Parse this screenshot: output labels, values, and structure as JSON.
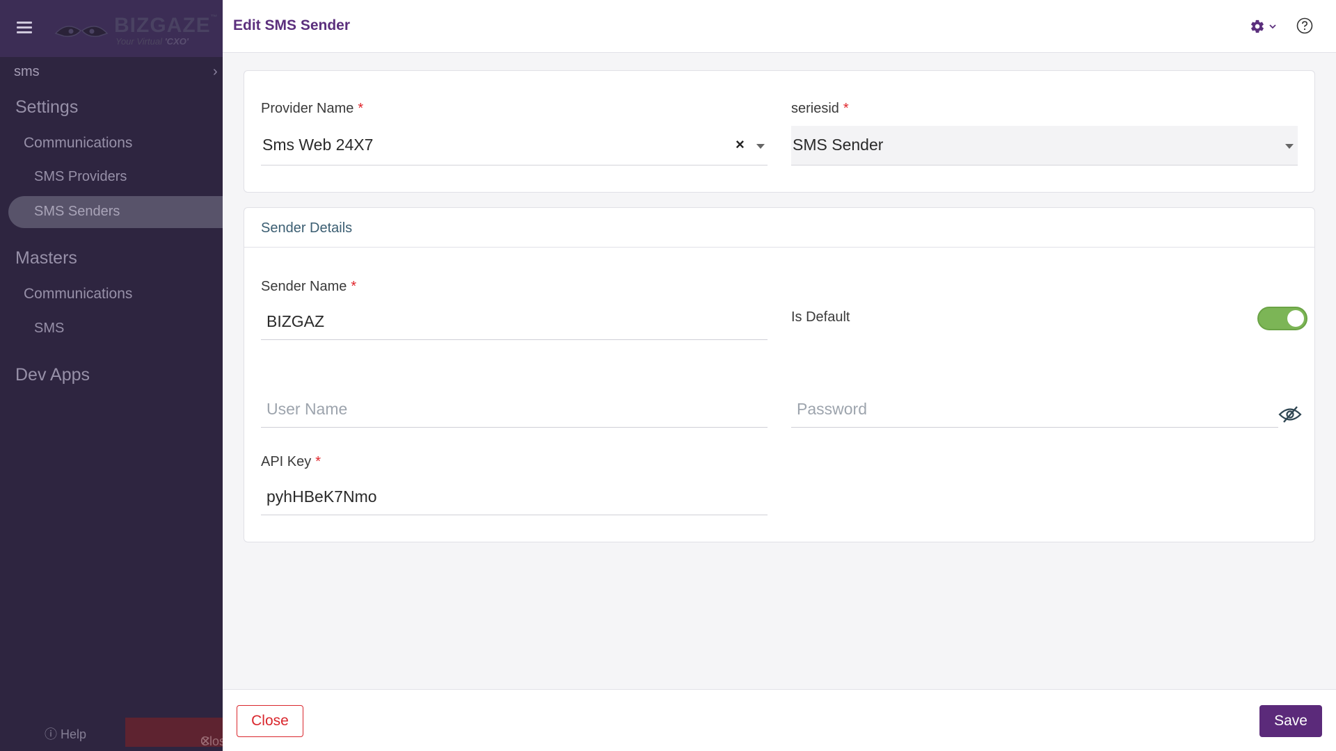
{
  "sidebar": {
    "logo": {
      "brand": "BIZGAZE",
      "tagline_prefix": "Your Virtual ",
      "tagline_highlight": "'CXO'"
    },
    "breadcrumb": "sms",
    "sections": [
      {
        "title": "Settings",
        "group": "Communications",
        "items": [
          "SMS Providers",
          "SMS Senders"
        ]
      },
      {
        "title": "Masters",
        "group": "Communications",
        "items": [
          "SMS"
        ]
      },
      {
        "title": "Dev Apps"
      }
    ],
    "active_item": "SMS Senders",
    "help_label": "Help",
    "close_label": "Close"
  },
  "header": {
    "title": "Edit SMS Sender",
    "icons": {
      "settings": "gear-icon",
      "dropdown": "chevron-down-icon",
      "help": "question-circle-icon"
    }
  },
  "form": {
    "provider": {
      "label": "Provider Name",
      "required": "*",
      "value": "Sms Web 24X7"
    },
    "series": {
      "label": "seriesid",
      "required": "*",
      "value": "SMS Sender"
    },
    "sender_details": {
      "title": "Sender Details",
      "sender_name": {
        "label": "Sender Name",
        "required": "*",
        "value": "BIZGAZ"
      },
      "is_default": {
        "label": "Is Default",
        "checked": true
      },
      "user_name": {
        "placeholder": "User Name",
        "value": ""
      },
      "password": {
        "placeholder": "Password",
        "value": ""
      },
      "api_key": {
        "label": "API Key",
        "required": "*",
        "value": "pyhHBeK7Nmo"
      }
    }
  },
  "footer": {
    "close_label": "Close",
    "save_label": "Save"
  },
  "colors": {
    "accent": "#5b2a7a",
    "danger": "#d9262c",
    "toggle_on": "#7cb556",
    "section_title": "#3b5e72"
  }
}
